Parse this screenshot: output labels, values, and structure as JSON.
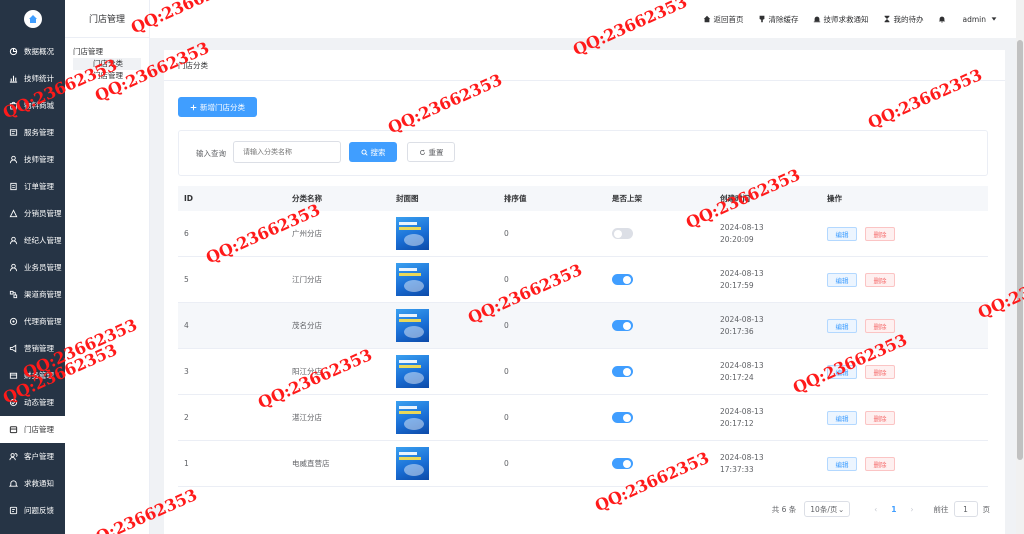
{
  "sidebar": {
    "items": [
      {
        "label": "数据概况",
        "icon": "pie-chart-icon",
        "active": false
      },
      {
        "label": "技师统计",
        "icon": "bar-chart-icon",
        "active": false
      },
      {
        "label": "物料商城",
        "icon": "shop-icon",
        "active": false
      },
      {
        "label": "服务管理",
        "icon": "service-icon",
        "active": false
      },
      {
        "label": "技师管理",
        "icon": "technician-icon",
        "active": false
      },
      {
        "label": "订单管理",
        "icon": "order-icon",
        "active": false
      },
      {
        "label": "分销员管理",
        "icon": "distributor-icon",
        "active": false
      },
      {
        "label": "经纪人管理",
        "icon": "broker-icon",
        "active": false
      },
      {
        "label": "业务员管理",
        "icon": "salesman-icon",
        "active": false
      },
      {
        "label": "渠道商管理",
        "icon": "channel-icon",
        "active": false
      },
      {
        "label": "代理商管理",
        "icon": "agent-icon",
        "active": false
      },
      {
        "label": "营销管理",
        "icon": "marketing-icon",
        "active": false
      },
      {
        "label": "财务管理",
        "icon": "finance-icon",
        "active": false
      },
      {
        "label": "动态管理",
        "icon": "dynamic-icon",
        "active": false
      },
      {
        "label": "门店管理",
        "icon": "store-icon",
        "active": true
      },
      {
        "label": "客户管理",
        "icon": "customer-icon",
        "active": false
      },
      {
        "label": "求救通知",
        "icon": "bell-icon",
        "active": false
      },
      {
        "label": "问题反馈",
        "icon": "feedback-icon",
        "active": false
      }
    ]
  },
  "subsidebar": {
    "title": "门店管理",
    "tree": {
      "parent": "门店管理",
      "children": [
        "门店分类",
        "门店管理"
      ],
      "selected": "门店分类"
    }
  },
  "header": {
    "links": [
      {
        "label": "返回首页",
        "icon": "home-icon"
      },
      {
        "label": "清除缓存",
        "icon": "clear-icon"
      },
      {
        "label": "技师求救通知",
        "icon": "alarm-icon"
      },
      {
        "label": "我的待办",
        "icon": "hourglass-icon"
      }
    ],
    "user": "admin"
  },
  "main": {
    "card_title": "门店分类",
    "add_button": "新增门店分类",
    "search": {
      "label": "输入查询",
      "placeholder": "请输入分类名称",
      "value": "",
      "search_button": "搜索",
      "reset_button": "重置"
    },
    "table": {
      "columns": [
        "ID",
        "分类名称",
        "封面图",
        "排序值",
        "是否上架",
        "创建时间",
        "操作"
      ],
      "rows": [
        {
          "id": "6",
          "name": "广州分店",
          "sort": "0",
          "listed": false,
          "date": "2024-08-13",
          "time": "20:20:09"
        },
        {
          "id": "5",
          "name": "江门分店",
          "sort": "0",
          "listed": true,
          "date": "2024-08-13",
          "time": "20:17:59"
        },
        {
          "id": "4",
          "name": "茂名分店",
          "sort": "0",
          "listed": true,
          "date": "2024-08-13",
          "time": "20:17:36"
        },
        {
          "id": "3",
          "name": "阳江分店",
          "sort": "0",
          "listed": true,
          "date": "2024-08-13",
          "time": "20:17:24"
        },
        {
          "id": "2",
          "name": "湛江分店",
          "sort": "0",
          "listed": true,
          "date": "2024-08-13",
          "time": "20:17:12"
        },
        {
          "id": "1",
          "name": "电威直营店",
          "sort": "0",
          "listed": true,
          "date": "2024-08-13",
          "time": "17:37:33"
        }
      ],
      "edit_label": "编辑",
      "delete_label": "删除"
    },
    "pagination": {
      "total": "共 6 条",
      "page_size": "10条/页",
      "current_page": "1",
      "goto_label": "前往",
      "goto_value": "1",
      "page_unit": "页"
    }
  },
  "watermark_text": "QQ:23662353",
  "colors": {
    "primary": "#409eff",
    "sidebar_bg": "#263445",
    "danger": "#f56c6c",
    "watermark": "#ff1a1a"
  }
}
